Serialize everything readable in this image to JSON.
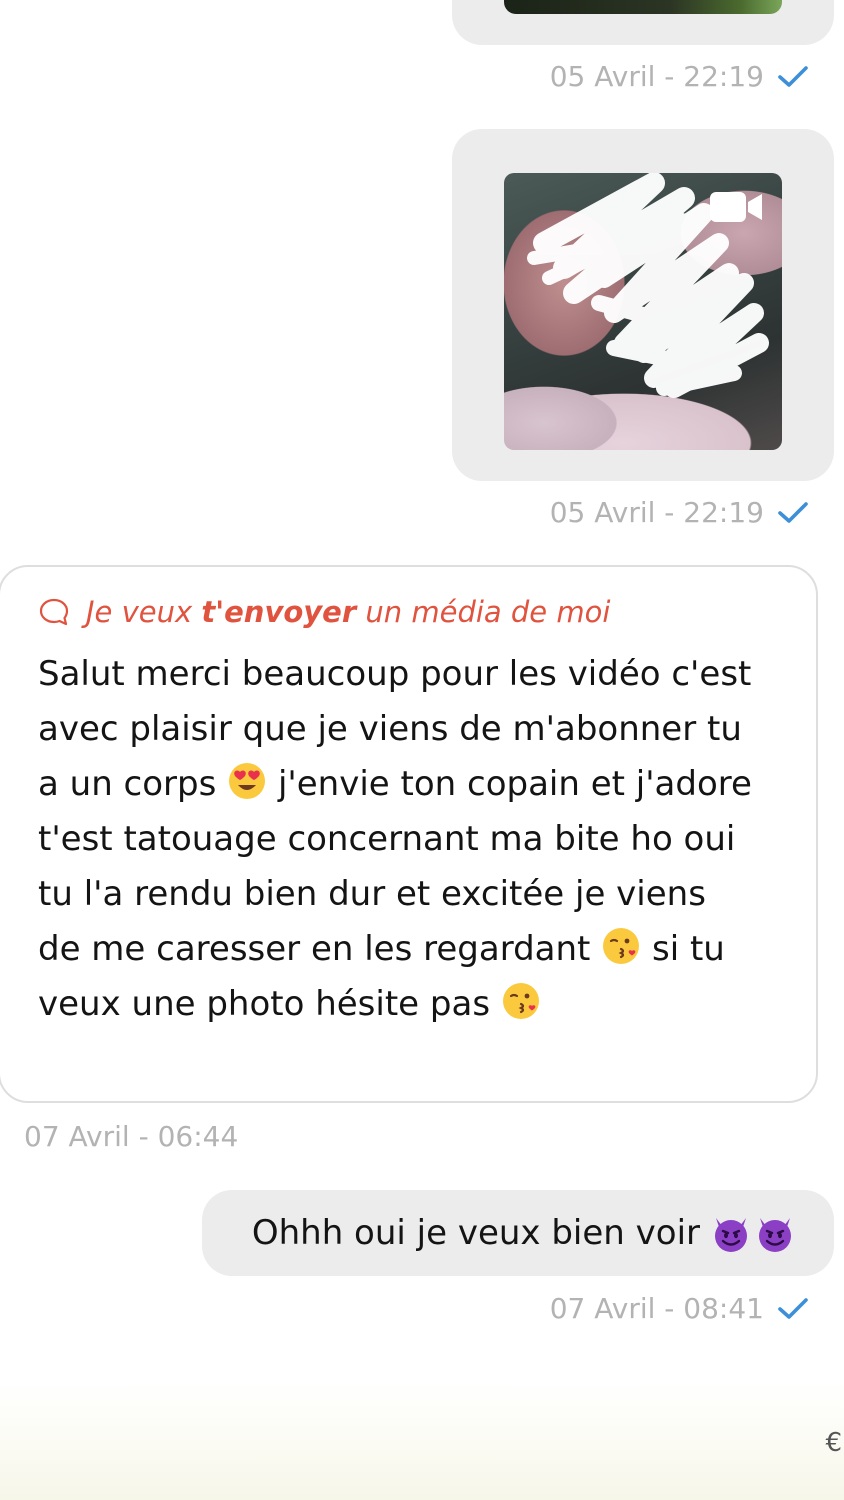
{
  "messages": [
    {
      "id": "sent-video-1",
      "direction": "sent",
      "type": "video",
      "timestamp": "05 Avril - 22:19",
      "read_status": "check-icon"
    },
    {
      "id": "sent-video-2",
      "direction": "sent",
      "type": "video",
      "media_icon": "video-camera-icon",
      "timestamp": "05 Avril - 22:19",
      "read_status": "check-icon"
    },
    {
      "id": "received-text",
      "direction": "received",
      "type": "text",
      "media_request": {
        "prefix": "Je veux ",
        "bold": "t'envoyer",
        "suffix": " un média de moi",
        "icon": "comment-icon"
      },
      "text_parts": [
        "Salut merci beaucoup pour les vidéo c'est avec plaisir que je viens de m'abonner tu a un corps",
        "j'envie ton copain et j'adore t'est tatouage concernant ma bite ho oui tu l'a rendu bien dur et excitée je viens de me caresser en les regardant",
        "si tu veux une photo hésite pas"
      ],
      "emojis": [
        "heart-eyes-emoji",
        "kiss-emoji",
        "kiss-emoji"
      ],
      "timestamp": "07 Avril - 06:44"
    },
    {
      "id": "sent-reply",
      "direction": "sent",
      "type": "text",
      "text": "Ohhh oui je veux bien voir",
      "emojis": [
        "smiling-devil-emoji",
        "smiling-devil-emoji"
      ],
      "timestamp": "07 Avril - 08:41",
      "read_status": "check-icon"
    }
  ],
  "colors": {
    "sent_bubble": "#ececec",
    "received_border": "#dedede",
    "timestamp": "#b3b3b3",
    "check": "#3d8fd8",
    "accent": "#e0533f",
    "text": "#141414"
  },
  "footer_glyph": "€"
}
